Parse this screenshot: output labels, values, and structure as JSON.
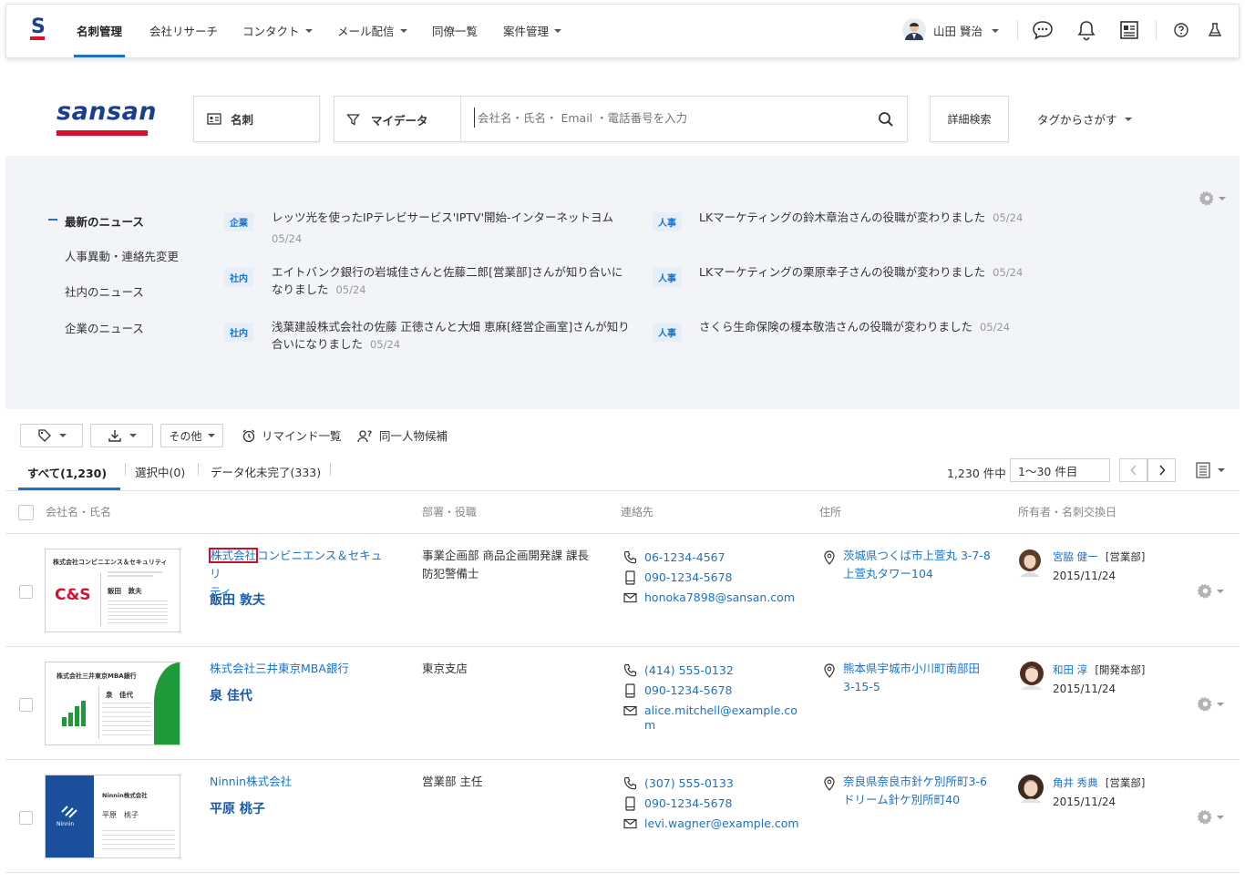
{
  "nav": {
    "logo": "S",
    "items": [
      {
        "label": "名刺管理",
        "active": true
      },
      {
        "label": "会社リサーチ"
      },
      {
        "label": "コンタクト",
        "dropdown": true
      },
      {
        "label": "メール配信",
        "dropdown": true
      },
      {
        "label": "同僚一覧"
      },
      {
        "label": "案件管理",
        "dropdown": true
      }
    ],
    "user_name": "山田 賢治"
  },
  "search": {
    "brand": "sansan",
    "type_label": "名刺",
    "scope_label": "マイデータ",
    "placeholder": "会社名・氏名・ Email ・電話番号を入力",
    "advanced_label": "詳細検索",
    "tag_search_label": "タグからさがす"
  },
  "news": {
    "categories": [
      "最新のニュース",
      "人事異動・連絡先変更",
      "社内のニュース",
      "企業のニュース"
    ],
    "left_items": [
      {
        "tag": "企業",
        "text1": "レッツ光を使ったIPテレビサービス'IPTV'開始-インターネットヨム",
        "text2": "",
        "date": "05/24"
      },
      {
        "tag": "社内",
        "text1": "エイトバンク銀行の岩城佳さんと佐藤二郎[営業部]さんが知り合いに",
        "text2": "なりました",
        "date": "05/24"
      },
      {
        "tag": "社内",
        "text1": "浅葉建設株式会社の佐藤 正徳さんと大畑 恵麻[経営企画室]さんが知り",
        "text2": "合いになりました",
        "date": "05/24"
      }
    ],
    "right_items": [
      {
        "tag": "人事",
        "text": "LKマーケティングの鈴木章治さんの役職が変わりました",
        "date": "05/24"
      },
      {
        "tag": "人事",
        "text": "LKマーケティングの栗原幸子さんの役職が変わりました",
        "date": "05/24"
      },
      {
        "tag": "人事",
        "text": "さくら生命保険の榎本敬浩さんの役職が変わりました",
        "date": "05/24"
      }
    ]
  },
  "toolbar": {
    "other_label": "その他",
    "remind_label": "リマインド一覧",
    "duplicate_label": "同一人物候補"
  },
  "tabs": {
    "all": "すべて(1,230)",
    "selected": "選択中(0)",
    "incomplete": "データ化未完了(333)"
  },
  "pager": {
    "total": "1,230 件中",
    "range": "1〜30 件目"
  },
  "table": {
    "headers": [
      "会社名・氏名",
      "部署・役職",
      "連絡先",
      "住所",
      "所有者・名刺交換日"
    ],
    "rows": [
      {
        "card_company": "株式会社コンビニエンス＆セキュリティ",
        "card_logo": "C&S",
        "card_person": "飯田　敦夫",
        "company_highlight": "株式会社",
        "company_rest": "コンビニエンス＆セキュリ",
        "company_line2": "ティ",
        "name": "飯田 敦夫",
        "dept1": "事業企画部 商品企画開発課 課長",
        "dept2": "防犯警備士",
        "phone": "06-1234-4567",
        "mobile": "090-1234-5678",
        "email1": "honoka7898@sansan.com",
        "email2": "",
        "addr1": "茨城県つくば市上萱丸 3-7-8",
        "addr2": "上萱丸タワー104",
        "owner": "宮脇 健一",
        "owner_dept": "[営業部]",
        "date": "2015/11/24"
      },
      {
        "card_company": "株式会社三井東京MBA銀行",
        "card_logo": "",
        "card_person": "泉　佳代",
        "company_highlight": "",
        "company_rest": "株式会社三井東京MBA銀行",
        "company_line2": "",
        "name": "泉 佳代",
        "dept1": "東京支店",
        "dept2": "",
        "phone": "(414) 555-0132",
        "mobile": "090-1234-5678",
        "email1": "alice.mitchell@example.co",
        "email2": "m",
        "addr1": "熊本県宇城市小川町南部田",
        "addr2": "3-15-5",
        "owner": "和田 淳",
        "owner_dept": "[開発本部]",
        "date": "2015/11/24"
      },
      {
        "card_company": "Ninnin株式会社",
        "card_logo": "Ninnin",
        "card_person": "平原　桃子",
        "company_highlight": "",
        "company_rest": "Ninnin株式会社",
        "company_line2": "",
        "name": "平原 桃子",
        "dept1": "営業部 主任",
        "dept2": "",
        "phone": "(307) 555-0133",
        "mobile": "090-1234-5678",
        "email1": "levi.wagner@example.com",
        "email2": "",
        "addr1": "奈良県奈良市針ケ別所町3-6",
        "addr2": "ドリーム針ケ別所町40",
        "owner": "角井 秀典",
        "owner_dept": "[営業部]",
        "date": "2015/11/24"
      }
    ]
  },
  "colors": {
    "accent": "#1a73c9",
    "brand_red": "#d7102f",
    "brand_navy": "#1a3f8f"
  }
}
